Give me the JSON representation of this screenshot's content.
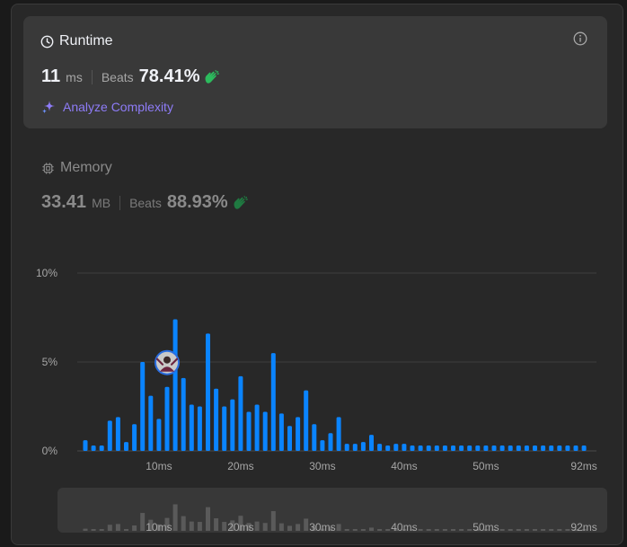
{
  "runtime": {
    "title": "Runtime",
    "value": "11",
    "unit": "ms",
    "beats_label": "Beats",
    "beats_pct": "78.41%",
    "analyze_label": "Analyze Complexity"
  },
  "memory": {
    "title": "Memory",
    "value": "33.41",
    "unit": "MB",
    "beats_label": "Beats",
    "beats_pct": "88.93%"
  },
  "colors": {
    "bar": "#0a84ff",
    "overview_bar": "#5a5a5a",
    "accent_purple": "#8e7cf8",
    "clap_green": "#2cbb5d"
  },
  "chart_data": {
    "type": "bar",
    "ylim": [
      0,
      10
    ],
    "yticks": [
      0,
      5,
      10
    ],
    "ytick_labels": [
      "0%",
      "5%",
      "10%"
    ],
    "xtick_labels": [
      {
        "x": 10,
        "label": "10ms"
      },
      {
        "x": 20,
        "label": "20ms"
      },
      {
        "x": 30,
        "label": "30ms"
      },
      {
        "x": 40,
        "label": "40ms"
      },
      {
        "x": 50,
        "label": "50ms"
      },
      {
        "x": 62,
        "label": "92ms"
      }
    ],
    "highlight_x": 11,
    "series": [
      {
        "x": [
          1,
          2,
          3,
          4,
          5,
          6,
          7,
          8,
          9,
          10,
          11,
          12,
          13,
          14,
          15,
          16,
          17,
          18,
          19,
          20,
          21,
          22,
          23,
          24,
          25,
          26,
          27,
          28,
          29,
          30,
          31,
          32,
          33,
          34,
          35,
          36,
          37,
          38,
          39,
          40,
          41,
          42,
          43,
          44,
          45,
          46,
          47,
          48,
          49,
          50,
          51,
          52,
          53,
          54,
          55,
          56,
          57,
          58,
          59,
          60,
          61,
          62
        ],
        "values": [
          0.6,
          0.3,
          0.3,
          1.7,
          1.9,
          0.5,
          1.5,
          5.0,
          3.1,
          1.8,
          3.6,
          7.4,
          4.1,
          2.6,
          2.5,
          6.6,
          3.5,
          2.5,
          2.9,
          4.2,
          2.2,
          2.6,
          2.2,
          5.5,
          2.1,
          1.4,
          1.9,
          3.4,
          1.5,
          0.6,
          1.0,
          1.9,
          0.4,
          0.4,
          0.5,
          0.9,
          0.4,
          0.3,
          0.4,
          0.4,
          0.3,
          0.3,
          0.3,
          0.3,
          0.3,
          0.3,
          0.3,
          0.3,
          0.3,
          0.3,
          0.3,
          0.3,
          0.3,
          0.3,
          0.3,
          0.3,
          0.3,
          0.3,
          0.3,
          0.3,
          0.3,
          0.3
        ]
      }
    ],
    "overview_xtick_labels": [
      "10ms",
      "20ms",
      "30ms",
      "40ms",
      "50ms",
      "92ms"
    ]
  }
}
